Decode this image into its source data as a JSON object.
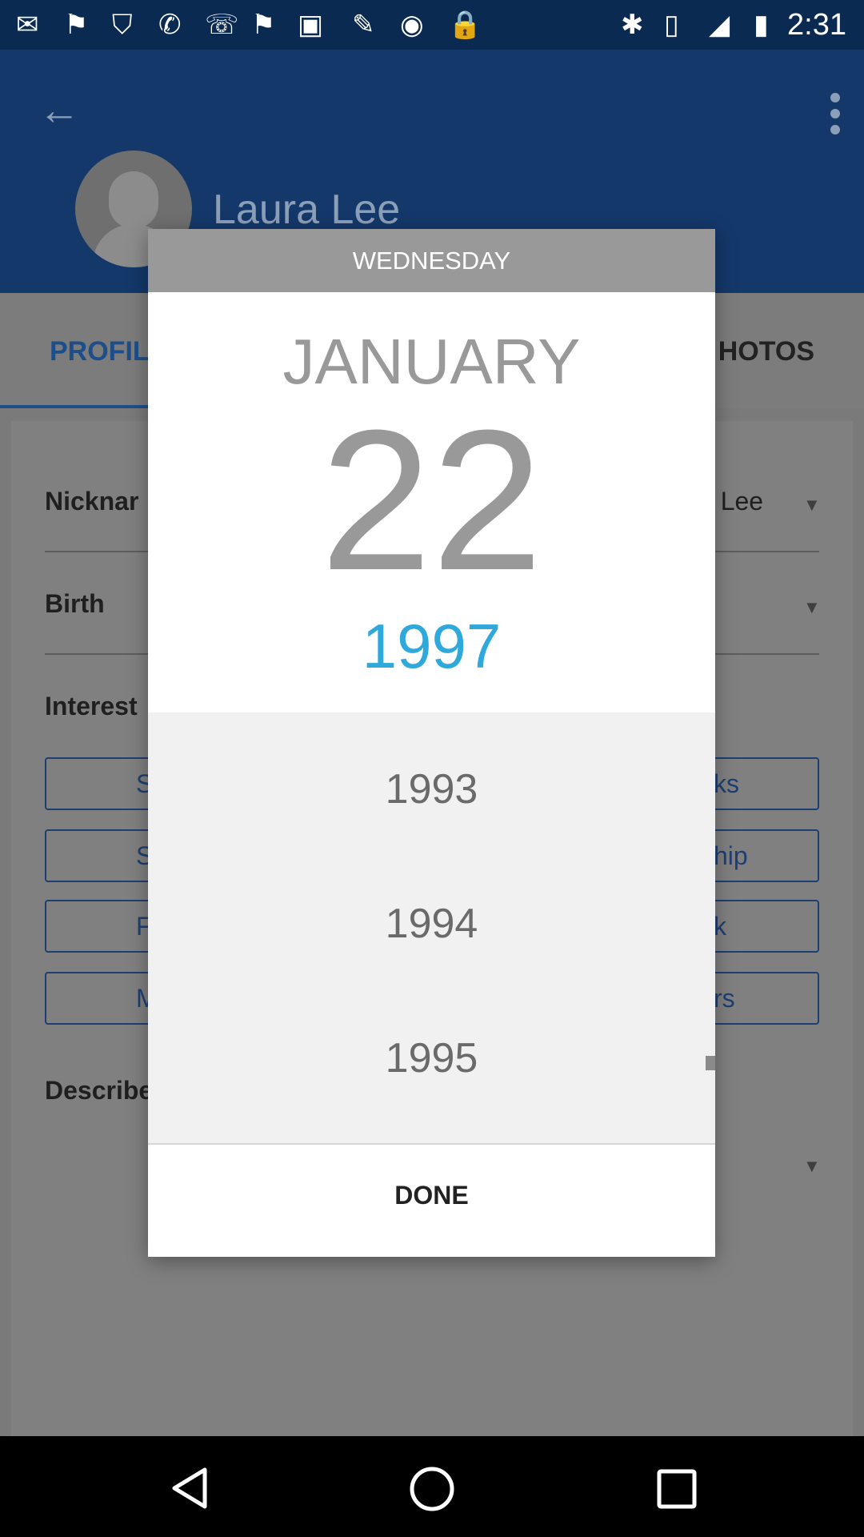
{
  "status_bar": {
    "time": "2:31",
    "icons": [
      "mail-icon",
      "flag-icon",
      "shield-icon",
      "sms-icon",
      "wifi-calling-icon",
      "flag-icon",
      "image-icon",
      "edit-icon",
      "radio-icon",
      "lock-icon",
      "bluetooth-icon",
      "vibrate-icon",
      "signal-icon",
      "battery-icon"
    ]
  },
  "app_bar": {
    "back_icon": "arrow-back-icon",
    "menu_icon": "more-vert-icon",
    "profile_name": "Laura Lee"
  },
  "tabs": {
    "profile": "PROFIL",
    "photos": "HOTOS"
  },
  "form": {
    "nickname_label": "Nicknar",
    "nickname_value": "a Lee",
    "birth_label": "Birth",
    "interests_label": "Interest",
    "describe_label": "Describe",
    "chips_left": [
      "Sp",
      "Sh",
      "F",
      "M"
    ],
    "chips_right": [
      "ks",
      "hip",
      "k",
      "rs"
    ]
  },
  "dialog": {
    "weekday": "WEDNESDAY",
    "month": "JANUARY",
    "day": "22",
    "selected_year": "1997",
    "years": [
      "1993",
      "1994",
      "1995"
    ],
    "done_label": "DONE",
    "accent_color": "#2fa8dc"
  },
  "navbar": {
    "icons": [
      "back-triangle-icon",
      "home-circle-icon",
      "recents-square-icon"
    ]
  }
}
